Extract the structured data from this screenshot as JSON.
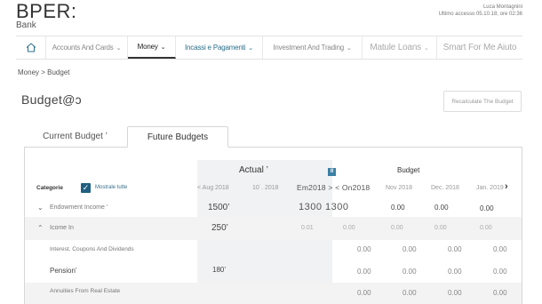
{
  "header": {
    "brand": "BPER:",
    "brand_sub": "Bank",
    "user_name": "Luca Montagnini",
    "last_access": "Ultimo accesso 05.10.18, ore 02:36"
  },
  "nav": {
    "home_icon": "home-icon",
    "items": [
      {
        "label": "Accounts And Cards"
      },
      {
        "label": "Money"
      },
      {
        "label": "Incassi e Pagamenti"
      },
      {
        "label": "Investment And Trading"
      },
      {
        "label": "Matule Loans"
      },
      {
        "label": "Smart For Me Aiuto"
      }
    ]
  },
  "breadcrumb": "Money > Budget",
  "page_title": "Budget@ↄ",
  "recalc_label": "Recalculate The Budget",
  "tabs": {
    "current": "Current Budget ’",
    "future": "Future Budgets"
  },
  "table": {
    "actual_label": "Actual ’",
    "budget_label": "Budget",
    "categories_label": "Categorie",
    "show_all_label": "Mostrale tutte",
    "columns": [
      "< Aug 2018",
      "10˙. 2018",
      "Em2018 > < On2018",
      "Nov 2018",
      "Dec. 2018",
      "Jan. 2019"
    ],
    "rows": [
      {
        "label": "Endowment Income ’",
        "values": [
          "1500’",
          "",
          "1300 1300",
          "0.00",
          "0.00",
          "0.00"
        ]
      },
      {
        "label": "Icome In",
        "values": [
          "250’",
          "",
          "0.01",
          "0.00",
          "0.00",
          "0.00",
          "0.00"
        ]
      },
      {
        "label": "Interest. Coupons And Dividends",
        "values": [
          "0.00",
          "0.00",
          "0.00",
          "0.00"
        ]
      },
      {
        "label": "Pension’",
        "values": [
          "180’",
          "0.00",
          "0.00",
          "0.00",
          "0.00"
        ]
      },
      {
        "label": "Annuities From Real Estate",
        "values": [
          "0.00",
          "0.00",
          "0.00",
          "0.00"
        ]
      }
    ]
  },
  "colors": {
    "accent": "#1f5f7f",
    "teal_nav": "#2a6f8a",
    "band": "#f1f2f3"
  }
}
